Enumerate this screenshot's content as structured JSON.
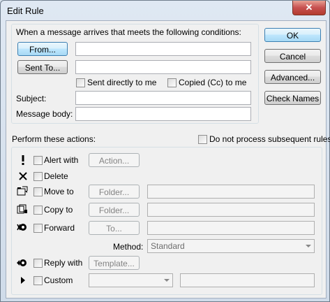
{
  "window": {
    "title": "Edit Rule",
    "close_glyph": "✕"
  },
  "conditions": {
    "heading": "When a message arrives that meets the following conditions:",
    "from_button": "From...",
    "sent_to_button": "Sent To...",
    "from_value": "",
    "sent_to_value": "",
    "sent_directly_label": "Sent directly to me",
    "copied_label": "Copied (Cc) to me",
    "subject_label": "Subject:",
    "subject_value": "",
    "body_label": "Message body:",
    "body_value": ""
  },
  "side_buttons": {
    "ok": "OK",
    "cancel": "Cancel",
    "advanced": "Advanced...",
    "check_names": "Check Names"
  },
  "actions": {
    "heading": "Perform these actions:",
    "do_not_process_label": "Do not process subsequent rules",
    "alert_label": "Alert with",
    "alert_button": "Action...",
    "delete_label": "Delete",
    "move_label": "Move to",
    "move_button": "Folder...",
    "copy_label": "Copy to",
    "copy_button": "Folder...",
    "forward_label": "Forward",
    "forward_button": "To...",
    "method_label": "Method:",
    "method_value": "Standard",
    "reply_label": "Reply with",
    "reply_button": "Template...",
    "custom_label": "Custom",
    "custom_value": ""
  },
  "icons": {
    "alert": "exclamation-icon",
    "delete": "x-delete-icon",
    "move": "move-folder-icon",
    "copy": "copy-folder-icon",
    "forward": "forward-icon",
    "reply": "reply-icon",
    "custom": "play-arrow-icon"
  }
}
